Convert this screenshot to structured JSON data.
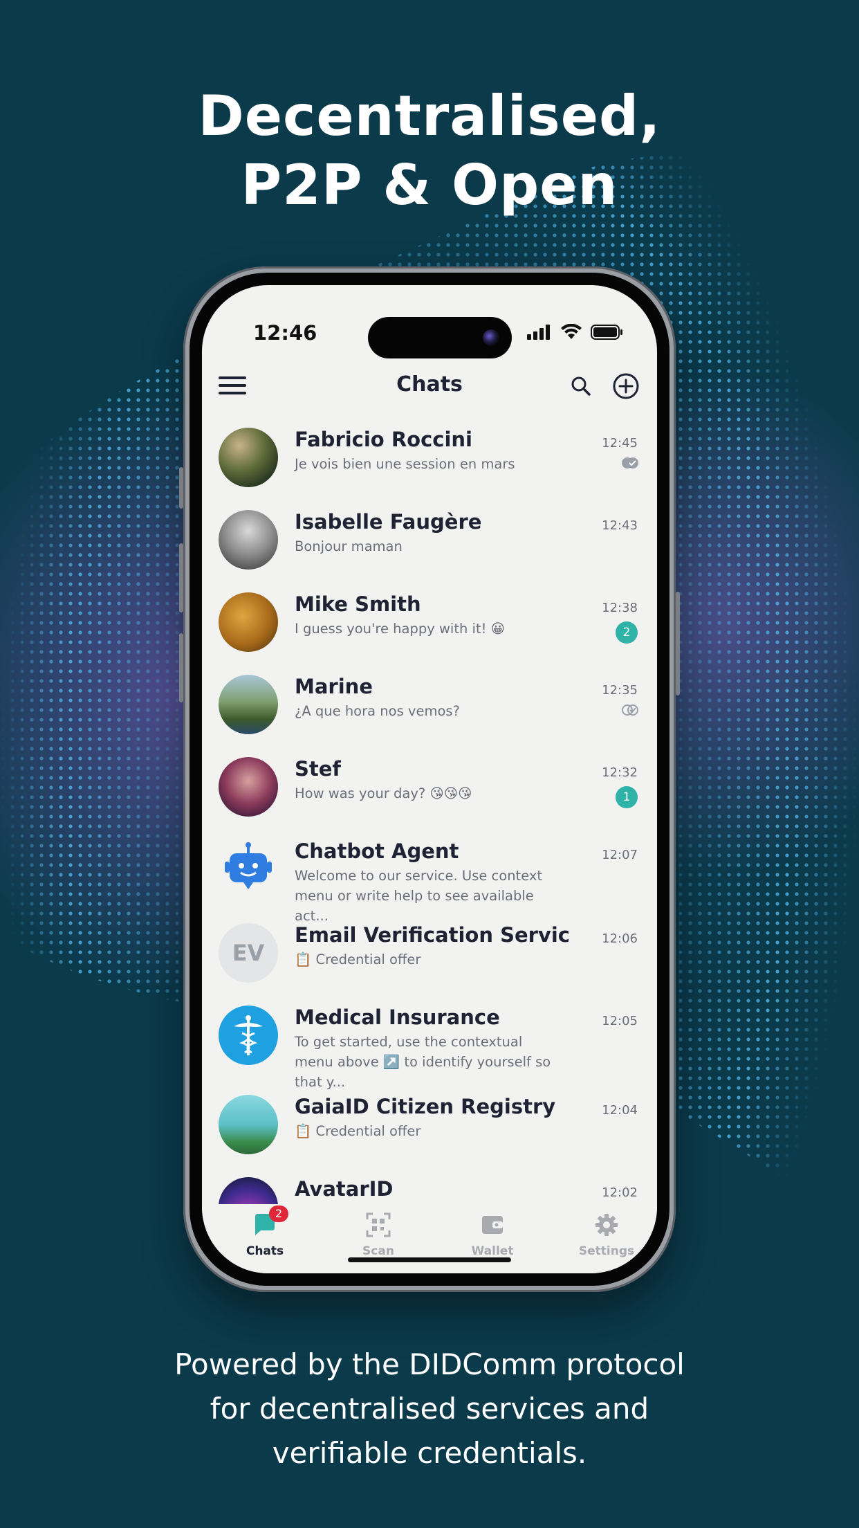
{
  "headline": {
    "line1": "Decentralised,",
    "line2": "P2P & Open"
  },
  "footer": {
    "line1": "Powered by the DIDComm protocol",
    "line2": "for decentralised services and",
    "line3": "verifiable credentials."
  },
  "status_bar": {
    "time": "12:46"
  },
  "header": {
    "title": "Chats",
    "menu_icon": "hamburger-menu-icon",
    "search_icon": "search-icon",
    "add_icon": "plus-circle-icon"
  },
  "chats": [
    {
      "name": "Fabricio Roccini",
      "message": "Je vois bien une session en mars",
      "time": "12:45",
      "status": "read"
    },
    {
      "name": "Isabelle Faugère",
      "message": "Bonjour maman",
      "time": "12:43",
      "status": ""
    },
    {
      "name": "Mike Smith",
      "message": "I guess you're happy with it! 😀",
      "time": "12:38",
      "unread": "2"
    },
    {
      "name": "Marine",
      "message": "¿A que hora nos vemos?",
      "time": "12:35",
      "status": "delivered"
    },
    {
      "name": "Stef",
      "message": "How was your day? 😘😘😘",
      "time": "12:32",
      "unread": "1"
    },
    {
      "name": "Chatbot Agent",
      "message": "Welcome to our service. Use context menu or write help to see available act...",
      "time": "12:07"
    },
    {
      "name": "Email Verification Servic...",
      "message": "📋 Credential offer",
      "time": "12:06",
      "initials": "EV"
    },
    {
      "name": "Medical Insurance",
      "message": "To get started, use the contextual menu above ↗️ to identify yourself so that y...",
      "time": "12:05"
    },
    {
      "name": "GaiaID Citizen Registry",
      "message": "📋 Credential offer",
      "time": "12:04"
    },
    {
      "name": "AvatarID",
      "message": "",
      "time": "12:02"
    }
  ],
  "tabs": [
    {
      "label": "Chats",
      "badge": "2",
      "icon": "chat-bubble-icon"
    },
    {
      "label": "Scan",
      "icon": "qr-scan-icon"
    },
    {
      "label": "Wallet",
      "icon": "wallet-icon"
    },
    {
      "label": "Settings",
      "icon": "gear-icon"
    }
  ],
  "colors": {
    "background": "#0b3a4b",
    "accent": "#2fb3a8",
    "badge": "#e0273a",
    "text_primary": "#1e2233"
  }
}
